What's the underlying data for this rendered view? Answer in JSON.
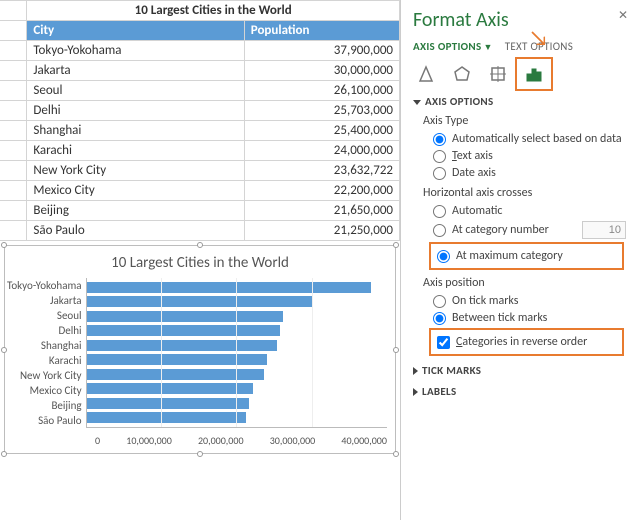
{
  "table": {
    "title": "10 Largest Cities in the World",
    "headers": {
      "city": "City",
      "pop": "Population"
    },
    "rows": [
      {
        "city": "Tokyo-Yokohama",
        "pop": "37,900,000"
      },
      {
        "city": "Jakarta",
        "pop": "30,000,000"
      },
      {
        "city": "Seoul",
        "pop": "26,100,000"
      },
      {
        "city": "Delhi",
        "pop": "25,703,000"
      },
      {
        "city": "Shanghai",
        "pop": "25,400,000"
      },
      {
        "city": "Karachi",
        "pop": "24,000,000"
      },
      {
        "city": "New York City",
        "pop": "23,632,722"
      },
      {
        "city": "Mexico City",
        "pop": "22,200,000"
      },
      {
        "city": "Beijing",
        "pop": "21,650,000"
      },
      {
        "city": "São Paulo",
        "pop": "21,250,000"
      }
    ]
  },
  "chart_data": {
    "type": "bar",
    "title": "10 Largest Cities in the World",
    "categories": [
      "Tokyo-Yokohama",
      "Jakarta",
      "Seoul",
      "Delhi",
      "Shanghai",
      "Karachi",
      "New York City",
      "Mexico City",
      "Beijing",
      "São Paulo"
    ],
    "values": [
      37900000,
      30000000,
      26100000,
      25703000,
      25400000,
      24000000,
      23632722,
      22200000,
      21650000,
      21250000
    ],
    "xlabel": "",
    "ylabel": "",
    "xlim": [
      0,
      40000000
    ],
    "x_ticks": [
      "0",
      "10,000,000",
      "20,000,000",
      "30,000,000",
      "40,000,000"
    ],
    "orientation": "horizontal"
  },
  "pane": {
    "title": "Format Axis",
    "tabs": {
      "options": "AXIS OPTIONS",
      "text": "TEXT OPTIONS"
    },
    "sections": {
      "axis_options": "AXIS OPTIONS",
      "tick_marks": "TICK MARKS",
      "labels": "LABELS"
    },
    "axis_type_label": "Axis Type",
    "axis_type": {
      "auto": "Automatically select based on data",
      "text": "Text axis",
      "date": "Date axis",
      "selected": "auto"
    },
    "crosses_label": "Horizontal axis crosses",
    "crosses": {
      "auto": "Automatic",
      "at_num": "At category number",
      "at_num_value": "10",
      "at_max": "At maximum category",
      "selected": "at_max"
    },
    "position_label": "Axis position",
    "position": {
      "on": "On tick marks",
      "between": "Between tick marks",
      "selected": "between"
    },
    "reverse_label": "Categories in reverse order",
    "reverse_checked": true
  }
}
